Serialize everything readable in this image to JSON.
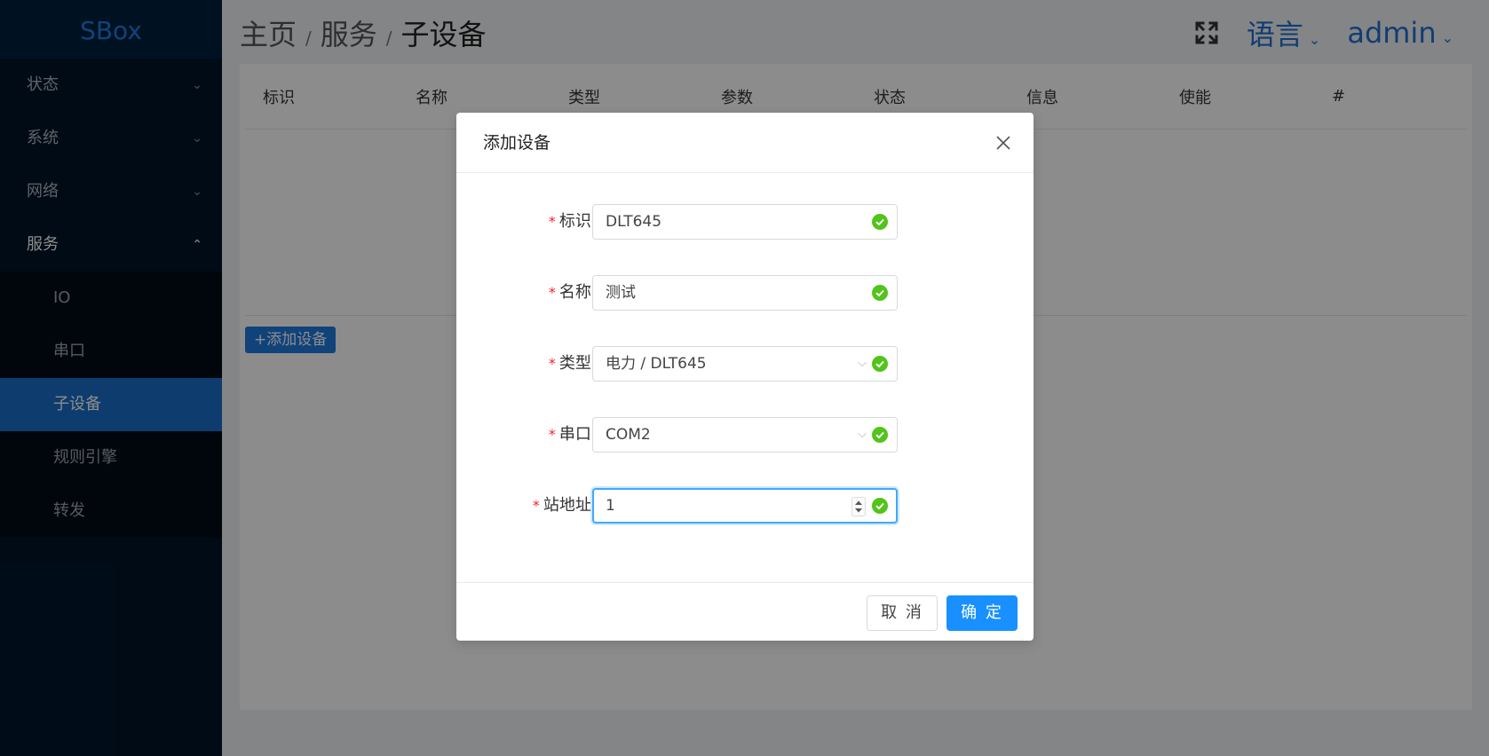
{
  "app": {
    "logo": "SBox"
  },
  "sidebar": {
    "items": [
      {
        "label": "状态",
        "chevron": "⌄"
      },
      {
        "label": "系统",
        "chevron": "⌄"
      },
      {
        "label": "网络",
        "chevron": "⌄"
      },
      {
        "label": "服务",
        "chevron": "⌃"
      }
    ],
    "sub_items": [
      {
        "label": "IO"
      },
      {
        "label": "串口"
      },
      {
        "label": "子设备"
      },
      {
        "label": "规则引擎"
      },
      {
        "label": "转发"
      }
    ]
  },
  "header": {
    "breadcrumb": [
      "主页",
      "服务",
      "子设备"
    ],
    "separator": "/",
    "language": "语言",
    "user": "admin",
    "caret": "⌄"
  },
  "table": {
    "columns": [
      "标识",
      "名称",
      "类型",
      "参数",
      "状态",
      "信息",
      "使能",
      "#"
    ]
  },
  "toolbar": {
    "add_label": "+添加设备"
  },
  "modal": {
    "title": "添加设备",
    "fields": {
      "id": {
        "label": "标识:",
        "value": "DLT645"
      },
      "name": {
        "label": "名称:",
        "value": "测试"
      },
      "type": {
        "label": "类型:",
        "value": "电力 / DLT645"
      },
      "serial": {
        "label": "串口:",
        "value": "COM2"
      },
      "station": {
        "label": "站地址:",
        "value": "1"
      }
    },
    "required_mark": "*",
    "select_arrow": "⌵",
    "cancel_label": "取 消",
    "ok_label": "确 定"
  },
  "colors": {
    "sidebar_bg": "#001529",
    "accent": "#1890ff",
    "active_menu": "#1a6dc8",
    "success": "#52c41a",
    "required": "#f5222d"
  }
}
